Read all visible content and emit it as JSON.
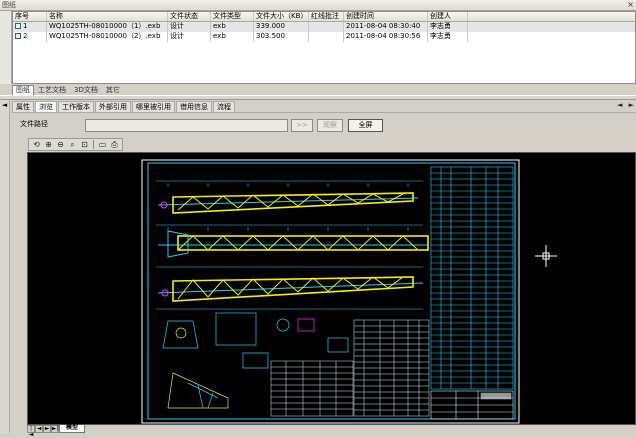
{
  "window": {
    "title": "图纸",
    "close": "×"
  },
  "grid": {
    "columns": [
      "序号",
      "名称",
      "文件状态",
      "文件类型",
      "文件大小（KB）",
      "红线批注",
      "创建时间",
      "创建人"
    ],
    "rows": [
      {
        "index": "1",
        "name": "WQ1025TH-08010000（1）.exb",
        "status": "设计",
        "type": "exb",
        "size": "339.000",
        "redline": "",
        "created": "2011-08-04 08:30:40",
        "creator": "李志勇"
      },
      {
        "index": "2",
        "name": "WQ1025TH-08010000（2）.exb",
        "status": "设计",
        "type": "exb",
        "size": "303.500",
        "redline": "",
        "created": "2011-08-04 08:30:56",
        "creator": "李志勇"
      }
    ]
  },
  "doc_tabs": [
    "图纸",
    "工艺文档",
    "3D文档",
    "其它"
  ],
  "left_pane": {
    "label": "档",
    "arrow": "◄"
  },
  "detail_tabs": [
    "属性",
    "浏览",
    "工作版本",
    "外部引用",
    "哪里被引用",
    "借用信息",
    "流程"
  ],
  "detail_tabs_active": 1,
  "tab_arrows": "◄ ►",
  "path": {
    "label": "文件路径",
    "value": ""
  },
  "buttons": {
    "browse": ">>",
    "view": "观察",
    "fullscreen": "全屏"
  },
  "toolbar_icons": [
    "rotate-icon",
    "zoom-in-icon",
    "zoom-out-icon",
    "zoom-window-icon",
    "zoom-fit-icon",
    "layer-icon",
    "print-preview-icon"
  ],
  "bottom": {
    "model_tab": "模型",
    "nav": [
      "|◄",
      "◄",
      "►",
      "►|"
    ]
  },
  "colors": {
    "drawing_bg": "#000000",
    "frame": "#1fd0ff",
    "truss": "#f5f000",
    "accent": "#ff30ff",
    "table": "#d0f0ff"
  }
}
